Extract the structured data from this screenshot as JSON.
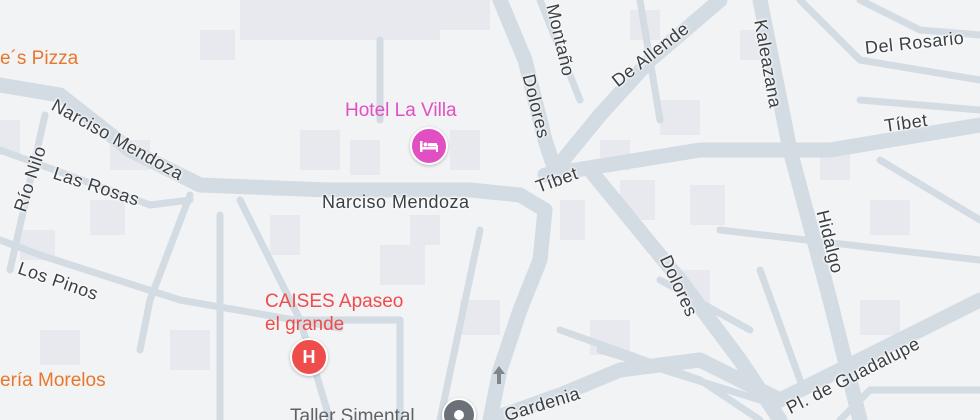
{
  "colors": {
    "background": "#f2f3f5",
    "road": "#d3dbe3",
    "block": "#e8e9ee",
    "hotel": "#e14fc3",
    "health": "#ef4c4c",
    "food": "#e8772a",
    "place": "#5f6368"
  },
  "streets": {
    "narciso_mendoza_main": "Narciso Mendoza",
    "narciso_mendoza_west": "Narciso Mendoza",
    "rio_nilo": "Río Nilo",
    "las_rosas": "Las Rosas",
    "los_pinos": "Los Pinos",
    "montano": "Montaño",
    "dolores_north": "Dolores",
    "dolores_south": "Dolores",
    "de_allende": "De Allende",
    "kaleazana": "Kaleazana",
    "del_rosario": "Del Rosario",
    "tibet_west": "Tíbet",
    "tibet_east": "Tíbet",
    "hidalgo": "Hidalgo",
    "pl_de_guadalupe": "Pl. de Guadalupe",
    "gardenia": "Gardenia"
  },
  "pois": {
    "hotel": {
      "name": "Hotel La Villa",
      "icon": "hotel-bed-icon"
    },
    "hospital": {
      "name_line1": "CAISES Apaseo",
      "name_line2": "el grande",
      "icon": "hospital-h-icon"
    },
    "pizza": {
      "name": "e´s Pizza"
    },
    "morelos": {
      "name": "ería Morelos"
    },
    "taller": {
      "name": "Taller Simental",
      "icon": "place-pin-icon"
    }
  }
}
